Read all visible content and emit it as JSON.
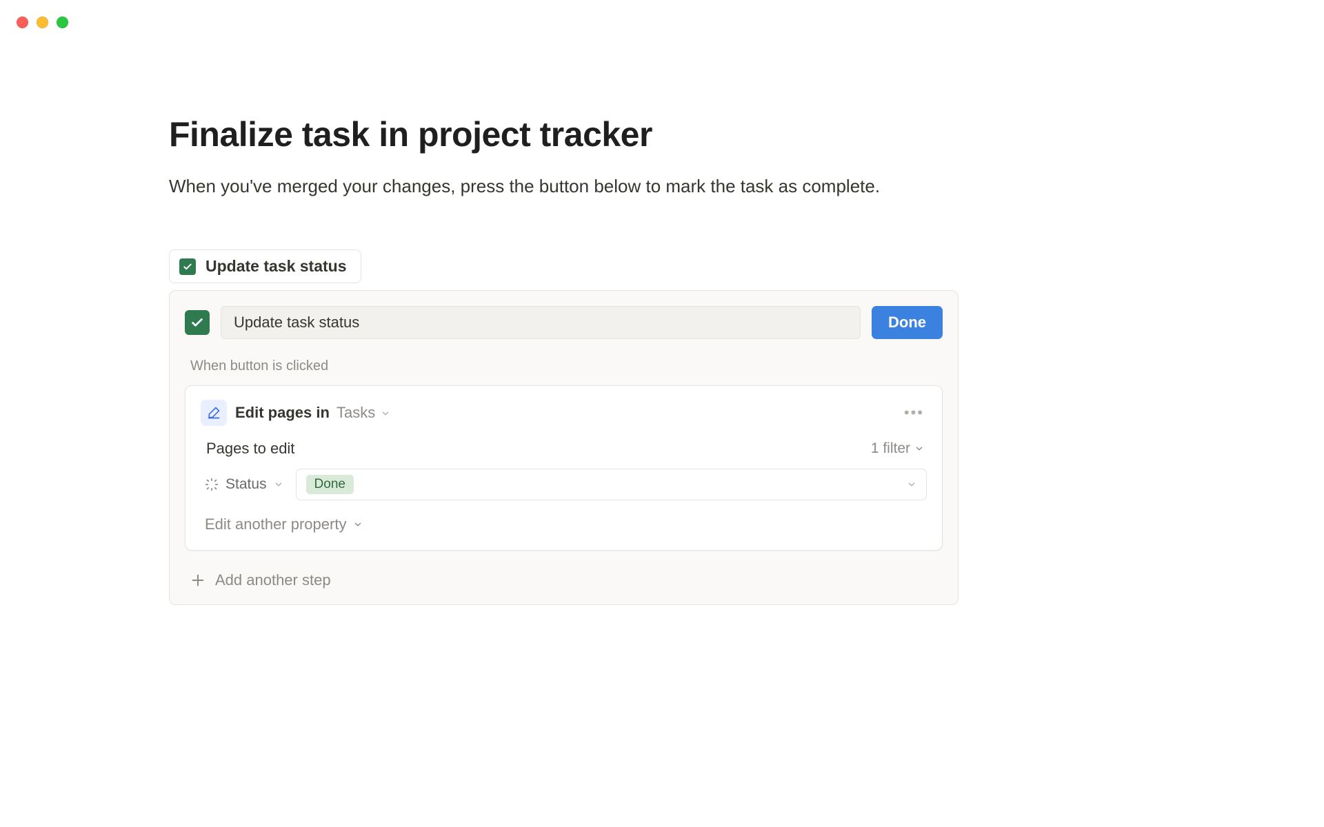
{
  "window": {
    "traffic_lights": [
      "close",
      "minimize",
      "zoom"
    ]
  },
  "page": {
    "title": "Finalize task in project tracker",
    "subtitle": "When you've merged your changes, press the button below to mark the task as complete."
  },
  "button_tab": {
    "label": "Update task status",
    "icon": "check-icon"
  },
  "config": {
    "button_name": "Update task status",
    "done_label": "Done",
    "trigger_label": "When button is clicked",
    "step": {
      "icon": "edit-icon",
      "action_label": "Edit pages in",
      "database_name": "Tasks",
      "pages_to_edit_label": "Pages to edit",
      "filter_summary": "1 filter",
      "property": {
        "icon": "status-icon",
        "name": "Status",
        "value_tag": "Done"
      },
      "edit_another_label": "Edit another property"
    },
    "add_step_label": "Add another step"
  }
}
